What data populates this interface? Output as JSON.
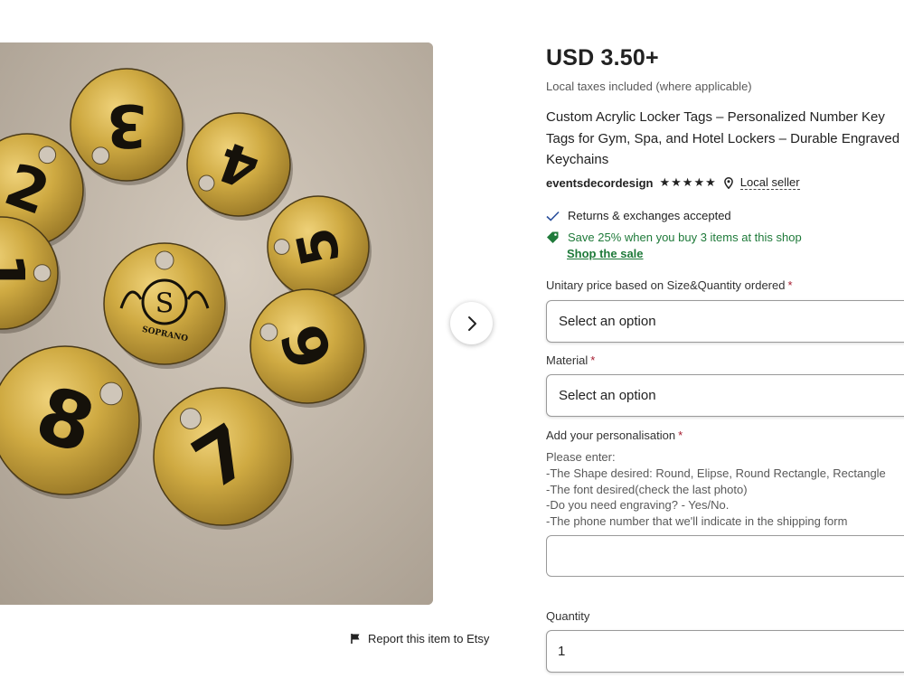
{
  "listing": {
    "price": "USD 3.50+",
    "taxes_note": "Local taxes included (where applicable)",
    "title": "Custom Acrylic Locker Tags – Personalized Number Key Tags for Gym, Spa, and Hotel Lockers – Durable Engraved Keychains",
    "seller": "eventsdecordesign",
    "rating_stars": "★★★★★",
    "local_seller": "Local seller"
  },
  "perks": {
    "returns": "Returns & exchanges accepted",
    "sale": "Save 25% when you buy 3 items at this shop",
    "shop_sale_link": "Shop the sale"
  },
  "options": {
    "unitary_label": "Unitary price based on Size&Quantity ordered",
    "unitary_value": "Select an option",
    "material_label": "Material",
    "material_value": "Select an option",
    "required_mark": "*"
  },
  "personalisation": {
    "label": "Add your personalisation",
    "instructions": [
      "Please enter:",
      "-The Shape desired: Round, Elipse, Round Rectangle, Rectangle",
      "-The font desired(check the last photo)",
      "-Do you need engraving? - Yes/No.",
      "-The phone number that we'll indicate in the shipping form"
    ],
    "value": ""
  },
  "quantity": {
    "label": "Quantity",
    "value": "1"
  },
  "gallery": {
    "report_link": "Report this item to Etsy",
    "tag_numbers": [
      "2",
      "3",
      "4",
      "5",
      "6",
      "7",
      "8",
      "1"
    ],
    "center_logo_letter": "S",
    "center_logo_text": "SOPRANO"
  },
  "colors": {
    "sale_green": "#1f7a3a",
    "required_red": "#a61a2e",
    "tag_gold": "#c9a53b"
  },
  "icons": {
    "next": "chevron-right-icon",
    "report": "flag-icon",
    "returns": "checkmark-icon",
    "sale": "tag-icon",
    "location": "location-pin-icon"
  }
}
